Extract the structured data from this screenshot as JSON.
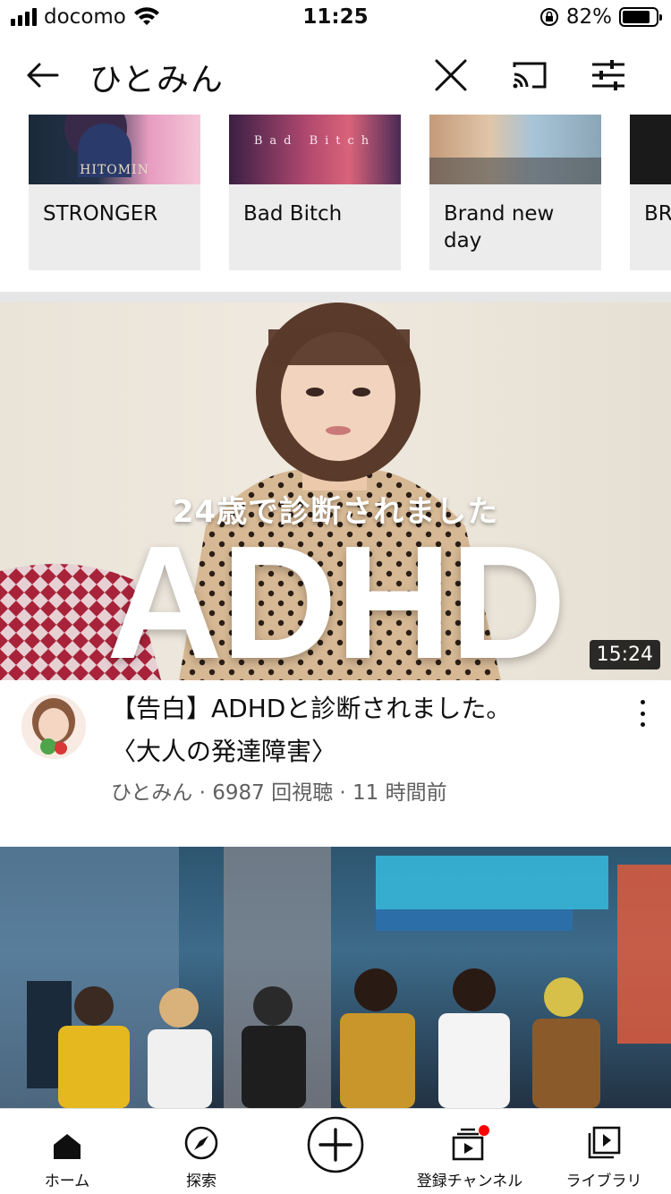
{
  "status_bar": {
    "carrier": "docomo",
    "time": "11:25",
    "battery": "82%",
    "battery_level": 0.82
  },
  "header": {
    "query": "ひとみん"
  },
  "shelf": [
    {
      "title": "STRONGER",
      "logo": "HITOMIN"
    },
    {
      "title": "Bad Bitch",
      "logo": "Bad  Bitch"
    },
    {
      "title": "Brand new day"
    },
    {
      "title": "BR DC"
    }
  ],
  "video1": {
    "thumb_sub": "24歳で診断されました",
    "thumb_big": "ADHD",
    "duration": "15:24",
    "title_line1": "【告白】ADHDと診断されました。",
    "title_line2": "〈大人の発達障害〉",
    "info": "ひとみん · 6987 回視聴 · 11 時間前"
  },
  "bottom_nav": {
    "home": "ホーム",
    "explore": "探索",
    "subscriptions": "登録チャンネル",
    "library": "ライブラリ"
  },
  "colors": {
    "badge_red": "#ff0000",
    "divider": "#e6e6e6",
    "card_bg": "#ececec"
  }
}
